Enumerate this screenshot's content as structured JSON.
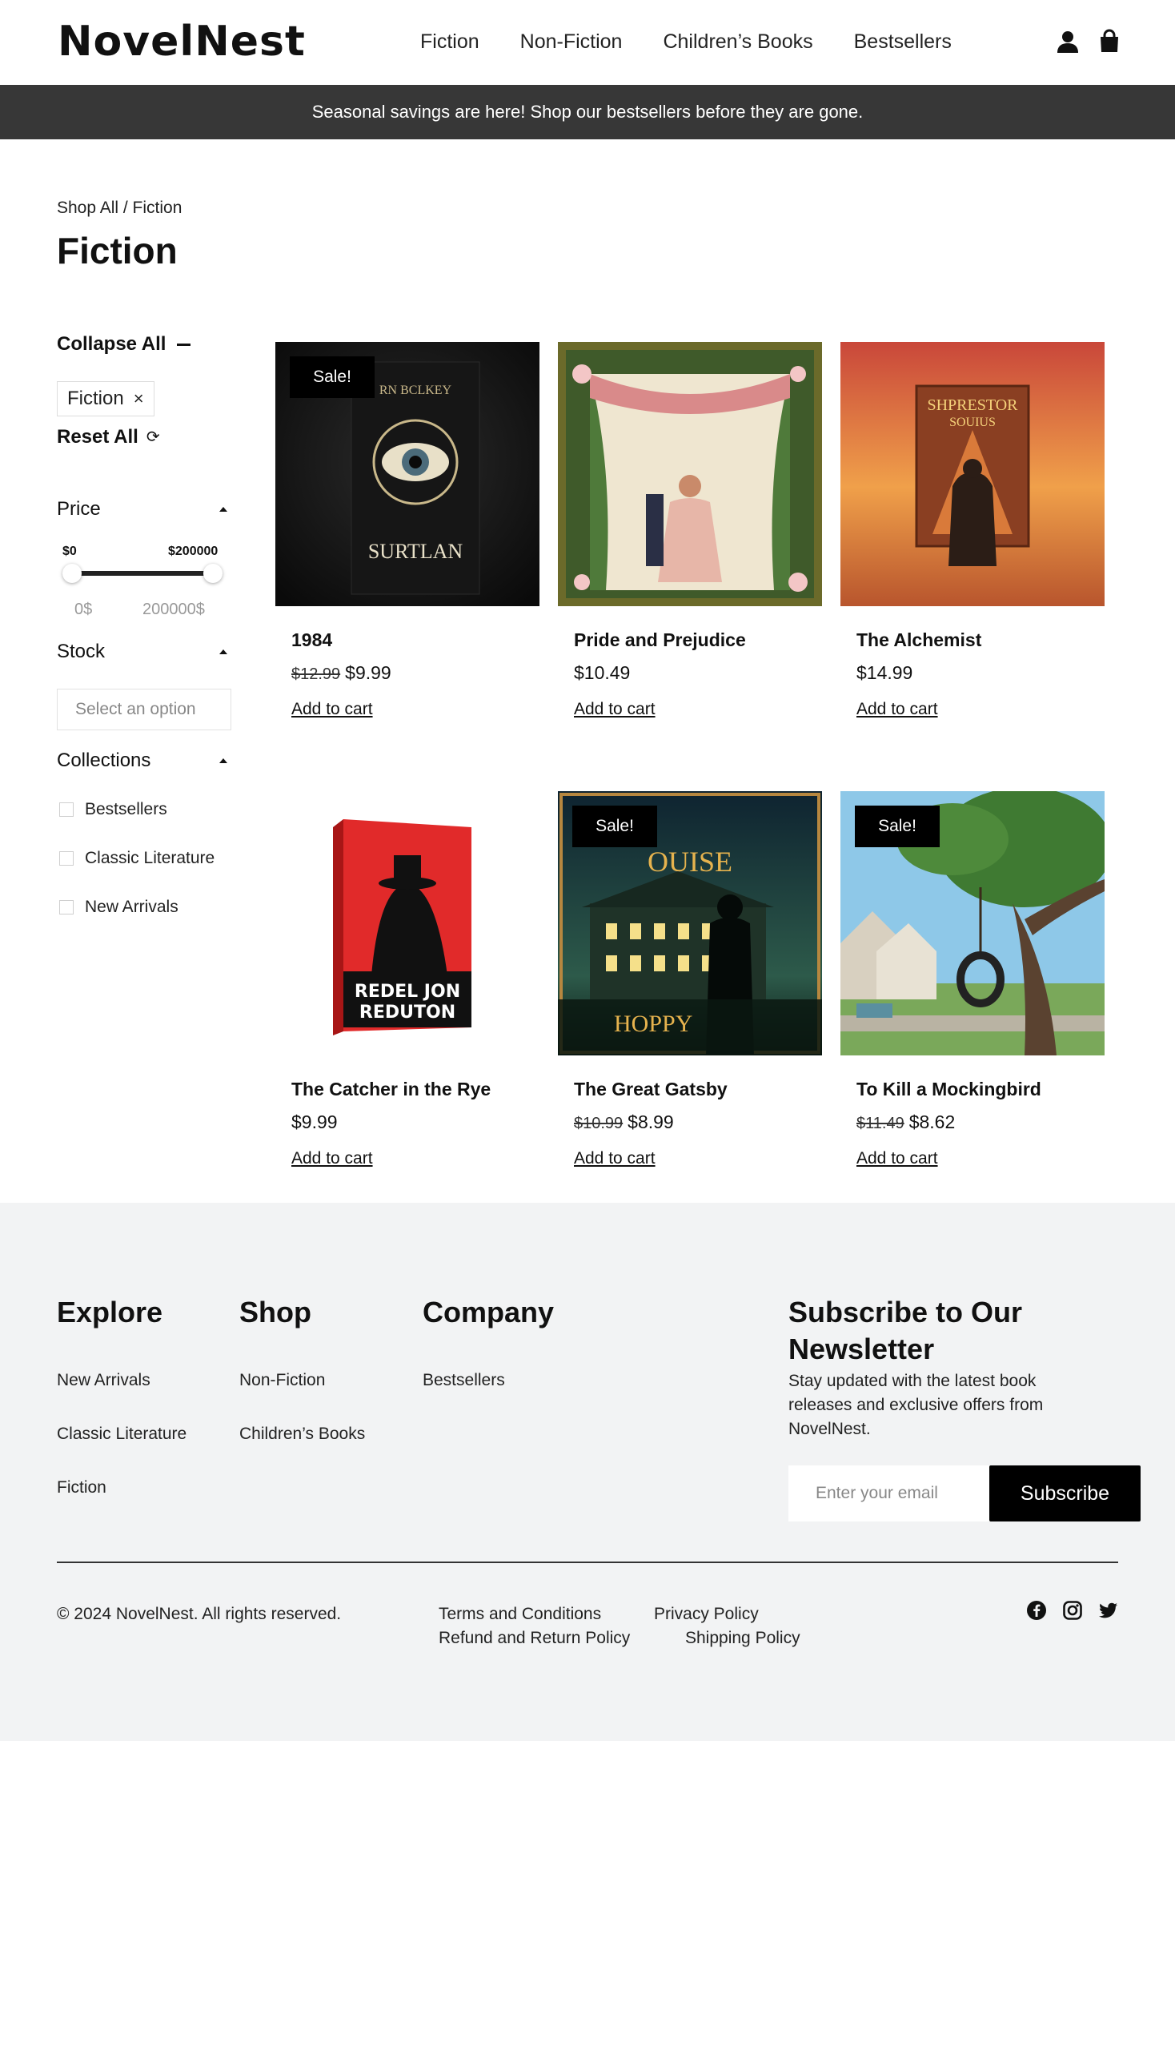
{
  "header": {
    "logo": "NovelNest",
    "nav": [
      "Fiction",
      "Non-Fiction",
      "Children’s Books",
      "Bestsellers"
    ],
    "icons": [
      "user-icon",
      "shopping-bag-icon"
    ]
  },
  "banner": "Seasonal savings are here! Shop our bestsellers before they are gone.",
  "breadcrumb": "Shop All / Fiction",
  "page_title": "Fiction",
  "filters": {
    "collapse_all": "Collapse All",
    "active_chip": "Fiction",
    "chip_close": "×",
    "reset_all": "Reset All",
    "reset_icon": "⟳",
    "price": {
      "label": "Price",
      "min_label": "$0",
      "max_label": "$200000",
      "range_min": "0$",
      "range_max": "200000$"
    },
    "stock": {
      "label": "Stock",
      "placeholder": "Select an option"
    },
    "collections": {
      "label": "Collections",
      "items": [
        "Bestsellers",
        "Classic Literature",
        "New Arrivals"
      ]
    }
  },
  "products": [
    {
      "title": "1984",
      "old_price": "$12.99",
      "price": "$9.99",
      "sale": "Sale!",
      "cta": "Add to cart"
    },
    {
      "title": "Pride and Prejudice",
      "old_price": "",
      "price": "$10.49",
      "sale": "",
      "cta": "Add to cart"
    },
    {
      "title": "The Alchemist",
      "old_price": "",
      "price": "$14.99",
      "sale": "",
      "cta": "Add to cart"
    },
    {
      "title": "The Catcher in the Rye",
      "old_price": "",
      "price": "$9.99",
      "sale": "",
      "cta": "Add to cart"
    },
    {
      "title": "The Great Gatsby",
      "old_price": "$10.99",
      "price": "$8.99",
      "sale": "Sale!",
      "cta": "Add to cart"
    },
    {
      "title": "To Kill a Mockingbird",
      "old_price": "$11.49",
      "price": "$8.62",
      "sale": "Sale!",
      "cta": "Add to cart"
    }
  ],
  "footer": {
    "explore": {
      "heading": "Explore",
      "links": [
        "New Arrivals",
        "Classic Literature",
        "Fiction"
      ]
    },
    "shop": {
      "heading": "Shop",
      "links": [
        "Non-Fiction",
        "Children’s Books"
      ]
    },
    "company": {
      "heading": "Company",
      "links": [
        "Bestsellers"
      ]
    },
    "newsletter": {
      "heading": "Subscribe to Our Newsletter",
      "text": "Stay updated with the latest book releases and exclusive offers from NovelNest.",
      "placeholder": "Enter your email",
      "button": "Subscribe"
    },
    "copyright": "© 2024 NovelNest. All rights reserved.",
    "legal": [
      "Terms and Conditions",
      "Privacy Policy",
      "Refund and Return Policy",
      "Shipping Policy"
    ],
    "social": [
      "facebook-icon",
      "instagram-icon",
      "twitter-icon"
    ]
  }
}
